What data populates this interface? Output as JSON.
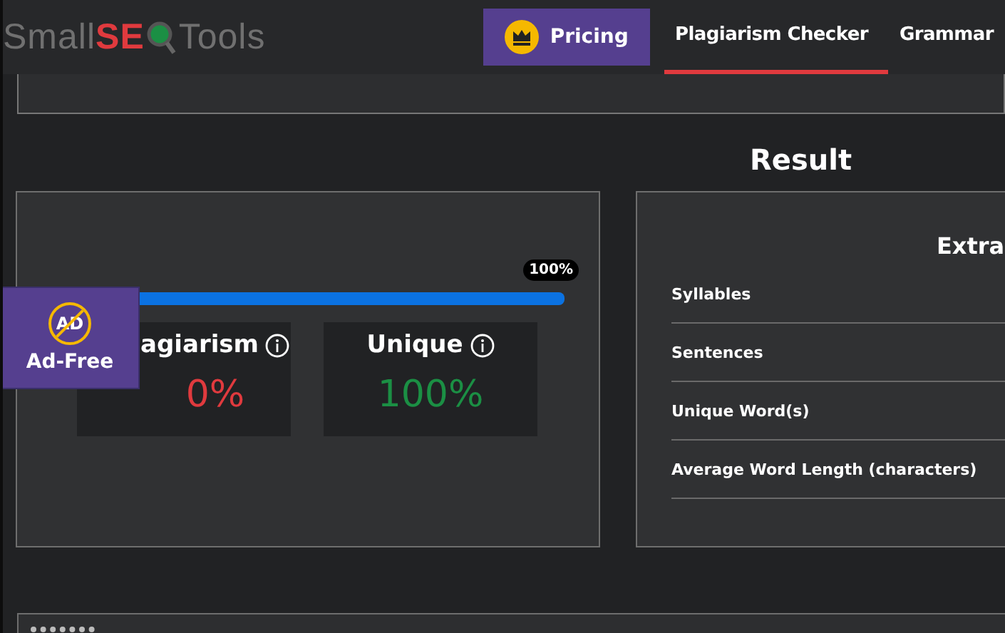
{
  "header": {
    "logo": {
      "parts": [
        "Small",
        "SE",
        "Tools"
      ]
    },
    "pricing_button": {
      "label": "Pricing"
    },
    "nav": [
      {
        "label": "Plagiarism Checker",
        "selected": true
      },
      {
        "label": "Grammar",
        "selected": false
      }
    ]
  },
  "result": {
    "title": "Result",
    "progress": {
      "level": 1.0,
      "label": "100%"
    },
    "stats": [
      {
        "label": "agiarism",
        "value": "0%",
        "color": "#e03a3e"
      },
      {
        "label": "Unique",
        "value": "100%",
        "color": "#1b8f44"
      }
    ],
    "ad_badge": {
      "label": "Ad-Free",
      "icon_text": "AD"
    }
  },
  "extra": {
    "title": "Extra",
    "rows": [
      "Syllables",
      "Sentences",
      "Unique Word(s)",
      "Average Word Length (characters)"
    ]
  }
}
